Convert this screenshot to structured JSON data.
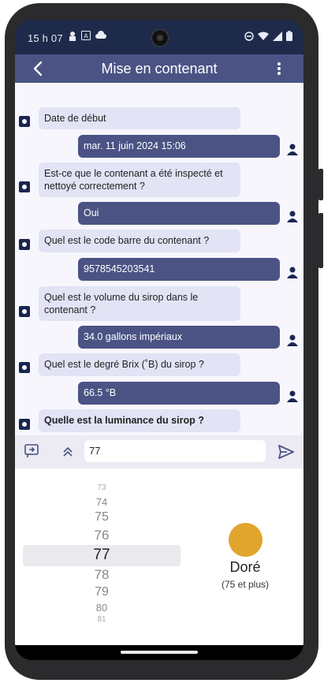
{
  "status": {
    "time": "15 h 07"
  },
  "appbar": {
    "title": "Mise en contenant",
    "back_icon": "back-arrow-icon",
    "menu_icon": "more-vert-icon"
  },
  "chat": {
    "q1": "Date de début",
    "a1": "mar. 11 juin 2024 15:06",
    "q2": "Est-ce que le contenant a été inspecté et nettoyé correctement ?",
    "a2": "Oui",
    "q3": "Quel est le code barre du contenant ?",
    "a3": "9578545203541",
    "q4": "Quel est le volume du sirop dans le contenant ?",
    "a4": "34.0 gallons impériaux",
    "q5": "Quel est le degré Brix (˚B) du sirop ?",
    "a5": "66.5 °B",
    "q6": "Quelle est la luminance du sirop ?"
  },
  "input": {
    "value": "77"
  },
  "picker": {
    "n73": "73",
    "n74": "74",
    "n75": "75",
    "n76": "76",
    "selected": "77",
    "n78": "78",
    "n79": "79",
    "n80": "80",
    "n81": "81"
  },
  "color": {
    "swatch": "#e1a52d",
    "name": "Doré",
    "range": "(75 et plus)"
  },
  "theme": {
    "primary": "#4a5384",
    "question_bg": "#e2e3f5",
    "status_bg": "#1e2a4a"
  }
}
